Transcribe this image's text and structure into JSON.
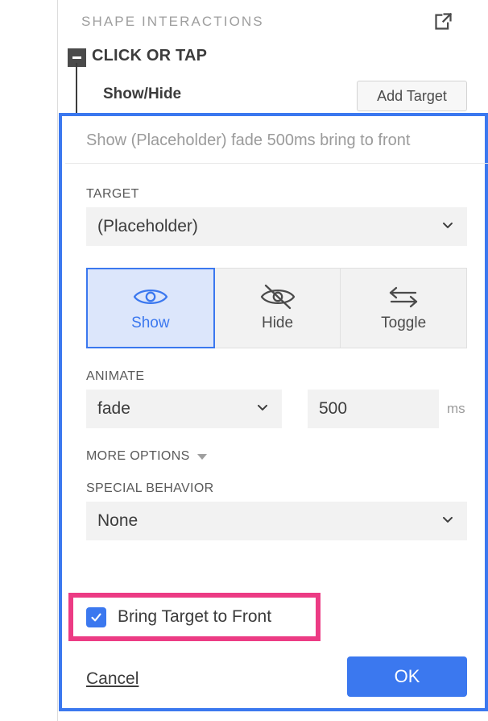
{
  "panel": {
    "title": "SHAPE INTERACTIONS",
    "popout_icon": "open-in-new-icon"
  },
  "trigger": {
    "label": "CLICK OR TAP",
    "collapse_icon": "minus-icon",
    "expanded": true
  },
  "action": {
    "label": "Show/Hide",
    "add_target_label": "Add Target"
  },
  "editor": {
    "summary": "Show (Placeholder) fade 500ms bring to front",
    "target": {
      "label": "TARGET",
      "value": "(Placeholder)",
      "chevron_icon": "chevron-down-icon"
    },
    "modes": [
      {
        "label": "Show",
        "icon": "eye-icon",
        "selected": true
      },
      {
        "label": "Hide",
        "icon": "eye-off-icon",
        "selected": false
      },
      {
        "label": "Toggle",
        "icon": "swap-arrows-icon",
        "selected": false
      }
    ],
    "animate": {
      "label": "ANIMATE",
      "effect_value": "fade",
      "duration_value": "500",
      "duration_placeholder": "0",
      "duration_unit": "ms",
      "chevron_icon": "chevron-down-icon"
    },
    "more_options": {
      "label": "MORE OPTIONS",
      "caret_icon": "triangle-down-icon"
    },
    "special_behavior": {
      "label": "SPECIAL BEHAVIOR",
      "value": "None",
      "chevron_icon": "chevron-down-icon"
    },
    "bring_to_front": {
      "label": "Bring Target to Front",
      "checked": true,
      "check_icon": "checkmark-icon"
    },
    "footer": {
      "cancel_label": "Cancel",
      "ok_label": "OK"
    }
  },
  "colors": {
    "accent_blue": "#3b78ef",
    "selected_fill": "#dce6fb",
    "annotation_pink": "#ec3b84",
    "field_gray": "#f2f2f2",
    "label_gray": "#5a5a5a",
    "muted_gray": "#9b9b9b",
    "dark_text": "#3c3c3c",
    "toggle_dark": "#4a4a4a"
  }
}
